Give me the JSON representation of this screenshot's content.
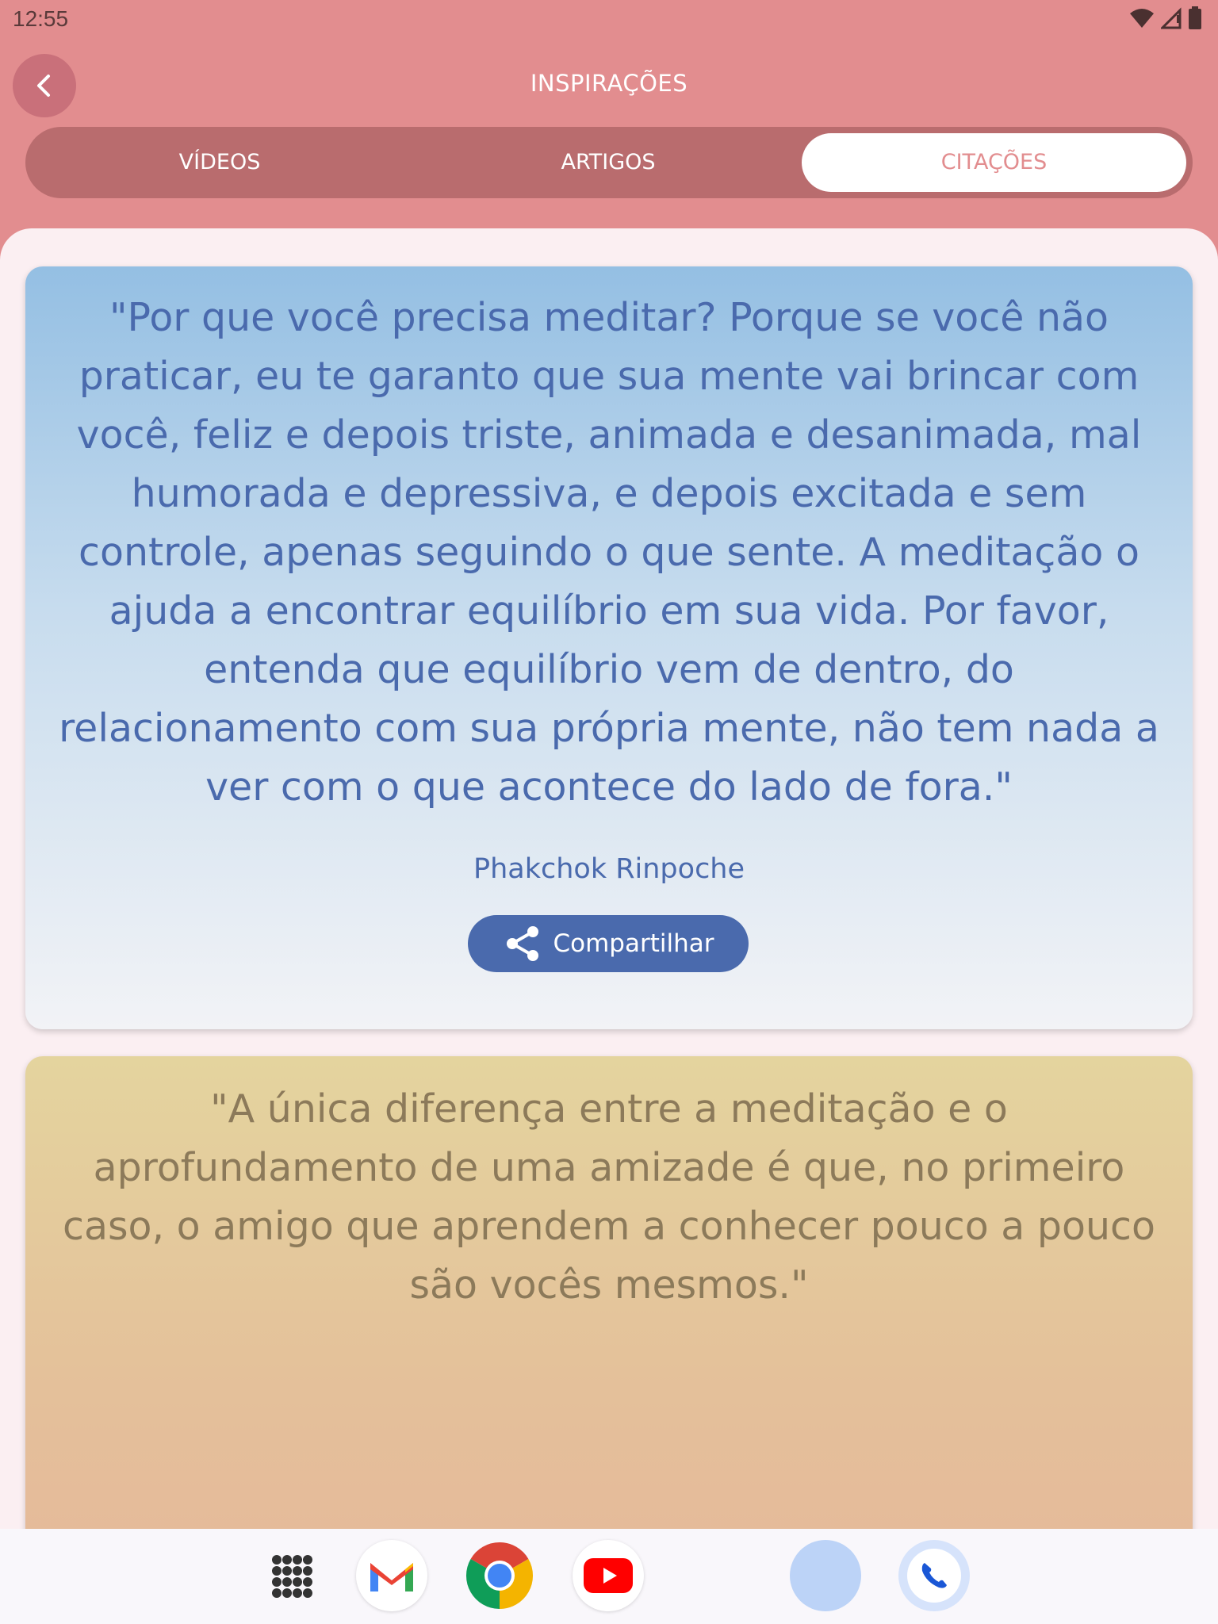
{
  "status_bar": {
    "time": "12:55",
    "icons": [
      "wifi-icon",
      "signal-icon",
      "battery-icon"
    ]
  },
  "app_bar": {
    "title": "INSPIRAÇÕES",
    "back_icon": "chevron-left-icon"
  },
  "tabs": [
    {
      "label": "VÍDEOS",
      "active": false
    },
    {
      "label": "ARTIGOS",
      "active": false
    },
    {
      "label": "CITAÇÕES",
      "active": true
    }
  ],
  "quotes": [
    {
      "text": "\"Por que você precisa meditar? Porque se você não praticar, eu te garanto que sua mente vai brincar com você, feliz e depois triste, animada e desanimada, mal humorada e depressiva, e depois excitada e sem controle, apenas seguindo o que sente. A meditação o ajuda a encontrar equilíbrio em sua vida. Por favor, entenda que equilíbrio vem de dentro, do relacionamento com sua própria mente, não tem nada a ver com o que acontece do lado de fora.\"",
      "author": "Phakchok Rinpoche",
      "share_label": "Compartilhar",
      "share_icon": "share-icon"
    },
    {
      "text": "\"A única diferença entre a meditação e o aprofundamento de uma amizade é que, no primeiro caso, o amigo que aprendem a conhecer pouco a pouco são vocês mesmos.\""
    }
  ],
  "dock": [
    "app-drawer-icon",
    "gmail-icon",
    "chrome-icon",
    "youtube-icon",
    "assistant-icon",
    "phone-icon"
  ],
  "colors": {
    "header": "#e28d8f",
    "tab_track": "#b96c6e",
    "card1_quote": "#4a6aad",
    "card2_quote": "#8c7a5a",
    "share_button": "#4a6aad"
  }
}
